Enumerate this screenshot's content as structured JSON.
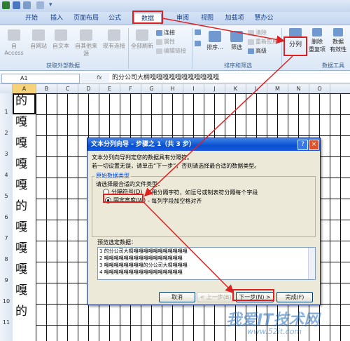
{
  "ribbon": {
    "tabs": [
      {
        "label": "开始"
      },
      {
        "label": "插入"
      },
      {
        "label": "页面布局"
      },
      {
        "label": "公式"
      },
      {
        "label": "数据"
      },
      {
        "label": "审阅"
      },
      {
        "label": "视图"
      },
      {
        "label": "加载项"
      },
      {
        "label": "慧办公"
      }
    ],
    "active_tab": "数据",
    "external_data": {
      "from_access": "自 Access",
      "from_web": "自网站",
      "from_text": "自文本",
      "from_other": "自其他来源",
      "existing": "现有连接",
      "group_label": "获取外部数据"
    },
    "connections": {
      "refresh_all": "全部刷新",
      "connect": "连接",
      "properties": "属性",
      "edit_links": "编辑链接"
    },
    "sort_filter": {
      "sort": "排序...",
      "filter": "筛选",
      "clear": "清除",
      "reapply": "重新应用",
      "advanced": "高级",
      "group_label": "排序和筛选"
    },
    "data_tools": {
      "split": "分列",
      "remove_dup": "删除",
      "remove_dup2": "重复项",
      "validation": "数据",
      "validation2": "有效性",
      "group_label": "数据工具"
    }
  },
  "formula_bar": {
    "cell_ref": "A1",
    "fx": "fx",
    "content": "的分公司大椆嘎嘎嘎嘎嘎嘎嘎嘎嘎嘎嘎"
  },
  "grid": {
    "columns": [
      "A",
      "B",
      "C",
      "D",
      "E",
      "F",
      "G",
      "H",
      "I",
      "J",
      "K",
      "L",
      "M",
      "N",
      "O"
    ],
    "rows": [
      "1",
      "2",
      "3",
      "4",
      "5",
      "6",
      "7",
      "8",
      "9",
      "10",
      "11"
    ],
    "col_a_chars": [
      "的",
      "嘎",
      "嘎",
      "嘎",
      "嘎",
      "的",
      "嘎",
      "嘎",
      "嘎",
      "嘎",
      "的"
    ]
  },
  "dialog": {
    "title": "文本分列向导 - 步骤之 1（共 3 步）",
    "help": "?",
    "close": "×",
    "line1": "文本分列向导判定您的数据具有分隔符。",
    "line2": "若一切设置无误，请单击“下一步”，否则请选择最合适的数据类型。",
    "group_title": "原始数据类型",
    "group_prompt": "请选择最合适的文件类型：",
    "opt_delimited": "分隔符号(D)",
    "opt_delimited_desc": "- 用分隔字符，如逗号或制表符分隔每个字段",
    "opt_fixed": "固定宽度(W)",
    "opt_fixed_desc": "- 每列字段加空格对齐",
    "preview_label": "预览选定数据：",
    "preview_lines": [
      "1 的分公司大椆嘎嘎嘎嘎嘎嘎嘎嘎嘎嘎嘎",
      "2 嘎嘎嘎嘎嘎嘎嘎嘎嘎嘎嘎嘎嘎嘎嘎嘎",
      "3 嘎嘎嘎嘎嘎嘎嘎嘎的分公司大椆嘎嘎嘎",
      "4 嘎嘎嘎嘎嘎嘎嘎嘎嘎嘎嘎嘎嘎嘎嘎嘎"
    ],
    "btn_cancel": "取消",
    "btn_back": "< 上一步(B)",
    "btn_next": "下一步(N) >",
    "btn_finish": "完成(F)"
  },
  "watermark": {
    "line1": "我爱IT技术网",
    "line2": "www.52it.com"
  },
  "colors": {
    "highlight": "#e02020",
    "ribbon_bg": "#dbe7f6",
    "dialog_title": "#0a4fd0"
  }
}
